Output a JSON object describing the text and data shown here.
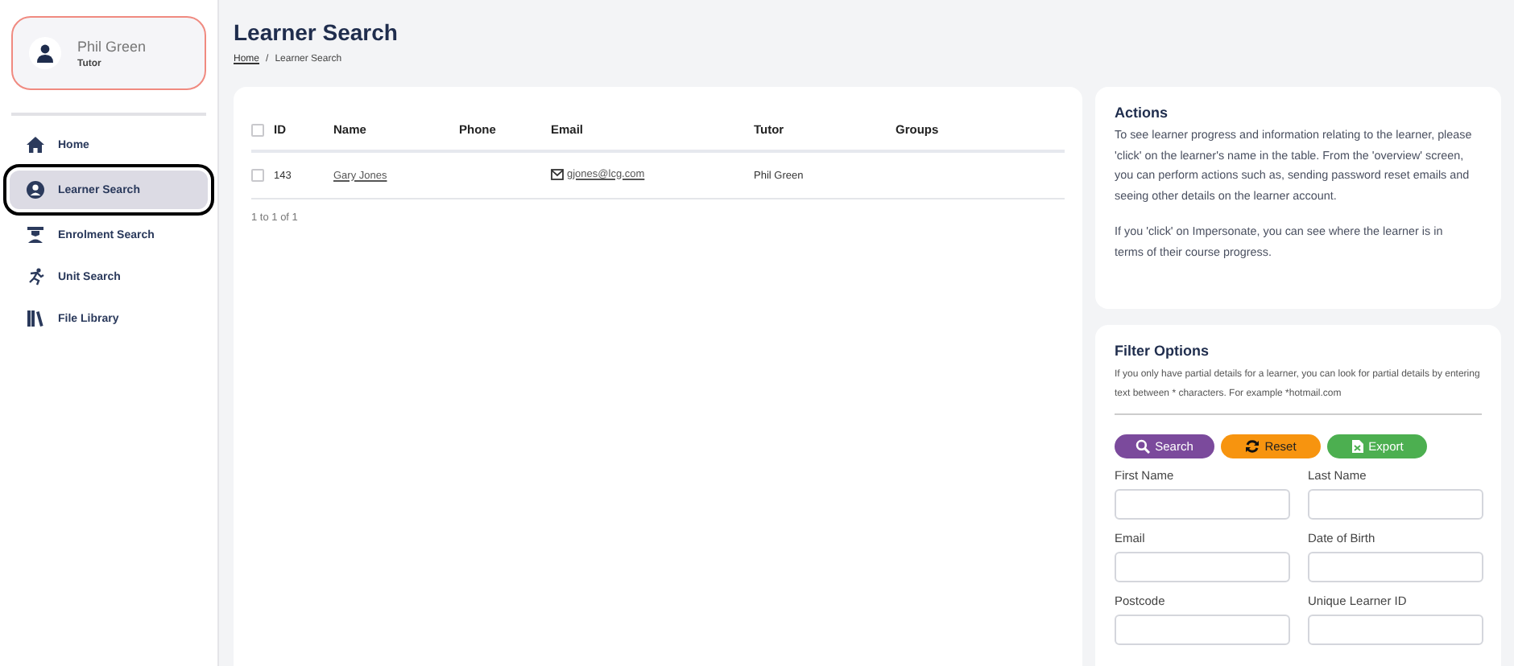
{
  "profile": {
    "name": "Phil Green",
    "role": "Tutor"
  },
  "nav": [
    {
      "label": "Home",
      "kind": "home",
      "selected": false
    },
    {
      "label": "Learner Search",
      "kind": "user",
      "selected": true
    },
    {
      "label": "Enrolment Search",
      "kind": "grad",
      "selected": false
    },
    {
      "label": "Unit Search",
      "kind": "run",
      "selected": false
    },
    {
      "label": "File Library",
      "kind": "books",
      "selected": false
    }
  ],
  "page": {
    "title": "Learner Search",
    "breadcrumb": [
      {
        "label": "Home",
        "kind": "link"
      },
      {
        "label": "/",
        "kind": "separator"
      },
      {
        "label": "Learner Search",
        "kind": "current"
      }
    ]
  },
  "table": {
    "select_all_checked": false,
    "columns": [
      "ID",
      "Name",
      "Phone",
      "Email",
      "Tutor",
      "Groups"
    ],
    "rows": [
      {
        "checked": false,
        "cells": [
          "143",
          "Gary Jones",
          "",
          "gjones@lcg.com",
          "Phil Green",
          ""
        ]
      }
    ],
    "footer": "1 to 1 of 1"
  },
  "actions": {
    "title": "Actions",
    "paragraphs": [
      "To see learner progress and information relating to the learner, please 'click' on the learner's name in the table. From the 'overview' screen, you can perform actions such as, sending password reset emails and seeing other details on the learner account.",
      "If you 'click' on Impersonate, you can see where the learner is in terms of their course progress."
    ]
  },
  "filter": {
    "title": "Filter Options",
    "hint": "If you only have partial details for a learner, you can look for partial details by entering text between * characters. For example *hotmail.com",
    "buttons": [
      {
        "label": "Search",
        "kind": "search"
      },
      {
        "label": "Reset",
        "kind": "reset"
      },
      {
        "label": "Export",
        "kind": "export"
      }
    ],
    "fields": [
      "First Name",
      "Last Name",
      "Email",
      "Date of Birth",
      "Postcode",
      "Unique Learner ID"
    ]
  }
}
